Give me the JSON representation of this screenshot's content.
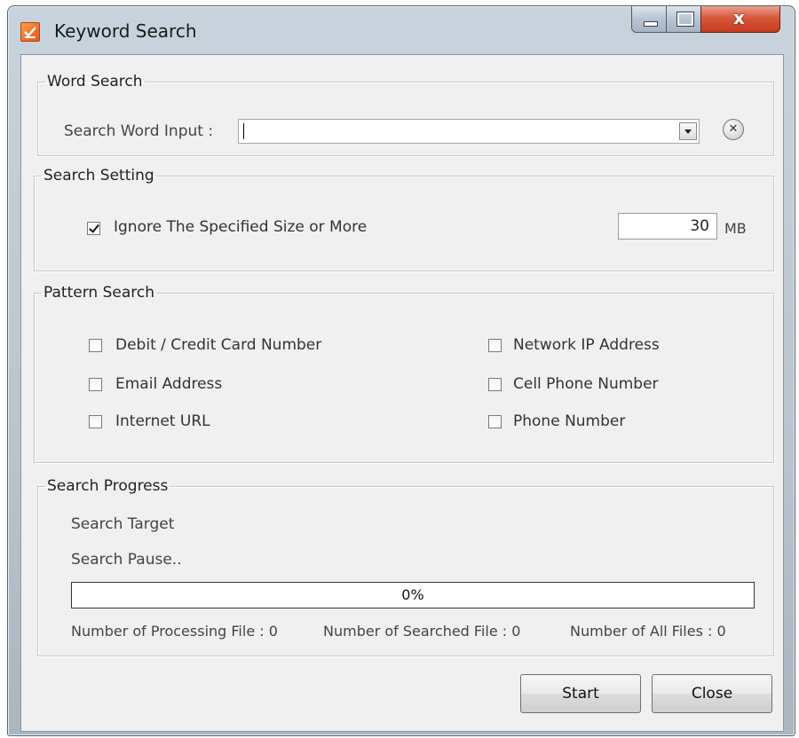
{
  "window": {
    "title": "Keyword Search"
  },
  "word_search": {
    "legend": "Word Search",
    "input_label": "Search Word Input :",
    "input_value": ""
  },
  "search_setting": {
    "legend": "Search Setting",
    "ignore_label": "Ignore The Specified Size or More",
    "ignore_checked": true,
    "size_value": "30",
    "size_unit": "MB"
  },
  "pattern_search": {
    "legend": "Pattern Search",
    "options": [
      {
        "label": "Debit / Credit Card Number",
        "checked": false
      },
      {
        "label": "Email Address",
        "checked": false
      },
      {
        "label": "Internet URL",
        "checked": false
      },
      {
        "label": "Network IP Address",
        "checked": false
      },
      {
        "label": "Cell Phone Number",
        "checked": false
      },
      {
        "label": "Phone Number",
        "checked": false
      }
    ]
  },
  "search_progress": {
    "legend": "Search Progress",
    "target_label": "Search Target",
    "status_label": "Search Pause..",
    "progress_percent": 0,
    "progress_text": "0%",
    "processing_files": "Number of Processing File : 0",
    "searched_files": "Number of Searched File : 0",
    "all_files": "Number of All Files : 0"
  },
  "buttons": {
    "start": "Start",
    "close": "Close"
  },
  "colors": {
    "progress_fill": "#3d8ee0",
    "close_button": "#c43c1f"
  }
}
